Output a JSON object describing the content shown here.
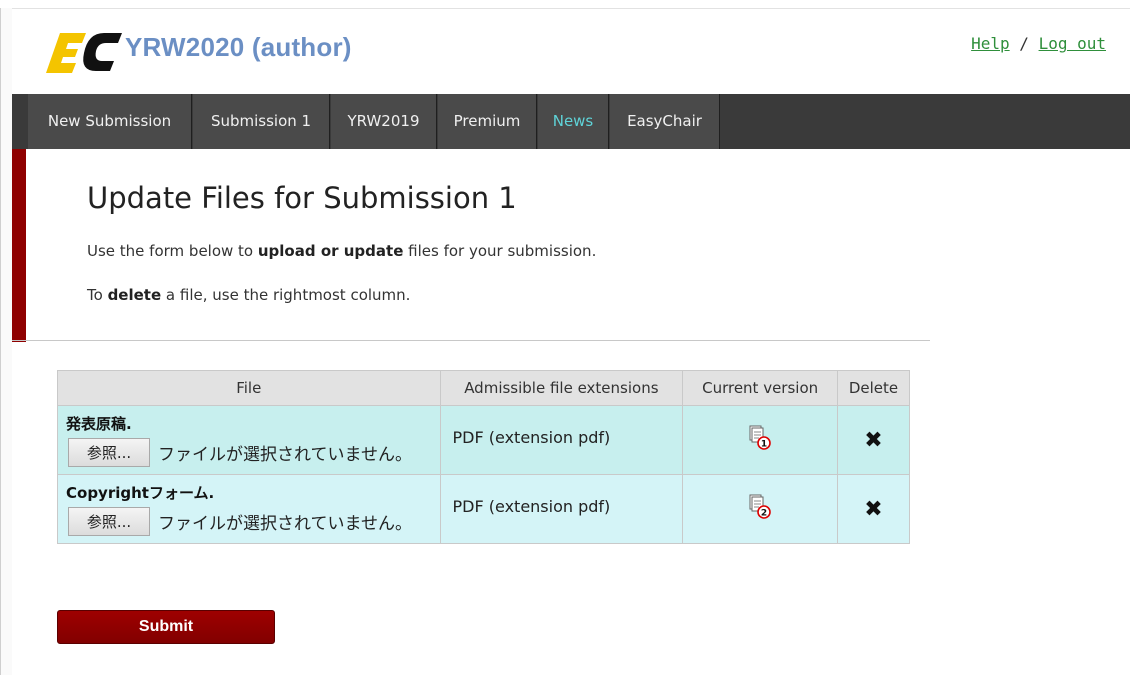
{
  "header": {
    "title": "YRW2020 (author)",
    "links": {
      "help": "Help",
      "separator": "/",
      "logout": "Log out"
    }
  },
  "nav": {
    "items": [
      {
        "label": "New Submission"
      },
      {
        "label": "Submission 1"
      },
      {
        "label": "YRW2019"
      },
      {
        "label": "Premium"
      },
      {
        "label": "News"
      },
      {
        "label": "EasyChair"
      }
    ],
    "active_color": "#5fd3d8"
  },
  "page": {
    "title": "Update Files for Submission 1",
    "line1": {
      "pre": "Use the form below to ",
      "bold": "upload or update",
      "post": " files for your submission."
    },
    "line2": {
      "pre": "To ",
      "bold": "delete",
      "post": " a file, use the rightmost column."
    }
  },
  "table": {
    "headers": [
      "File",
      "Admissible file extensions",
      "Current version",
      "Delete"
    ],
    "rows": [
      {
        "file_label": "発表原稿.",
        "browse_label": "参照...",
        "no_file_text": "ファイルが選択されていません。",
        "extensions": "PDF (extension pdf)",
        "version_number": "1",
        "version_icon": "document-version-icon",
        "delete_icon": "delete-x-icon",
        "delete_symbol": "✖"
      },
      {
        "file_label": "Copyrightフォーム.",
        "browse_label": "参照...",
        "no_file_text": "ファイルが選択されていません。",
        "extensions": "PDF (extension pdf)",
        "version_number": "2",
        "version_icon": "document-version-icon",
        "delete_icon": "delete-x-icon",
        "delete_symbol": "✖"
      }
    ]
  },
  "submit_label": "Submit",
  "colors": {
    "brand_blue": "#6b8fc4",
    "accent_red": "#8f0000",
    "nav_bg": "#3a3a3a",
    "row1_bg": "#c7efee",
    "row2_bg": "#d4f4f7",
    "link_green": "#2f8f3b"
  }
}
